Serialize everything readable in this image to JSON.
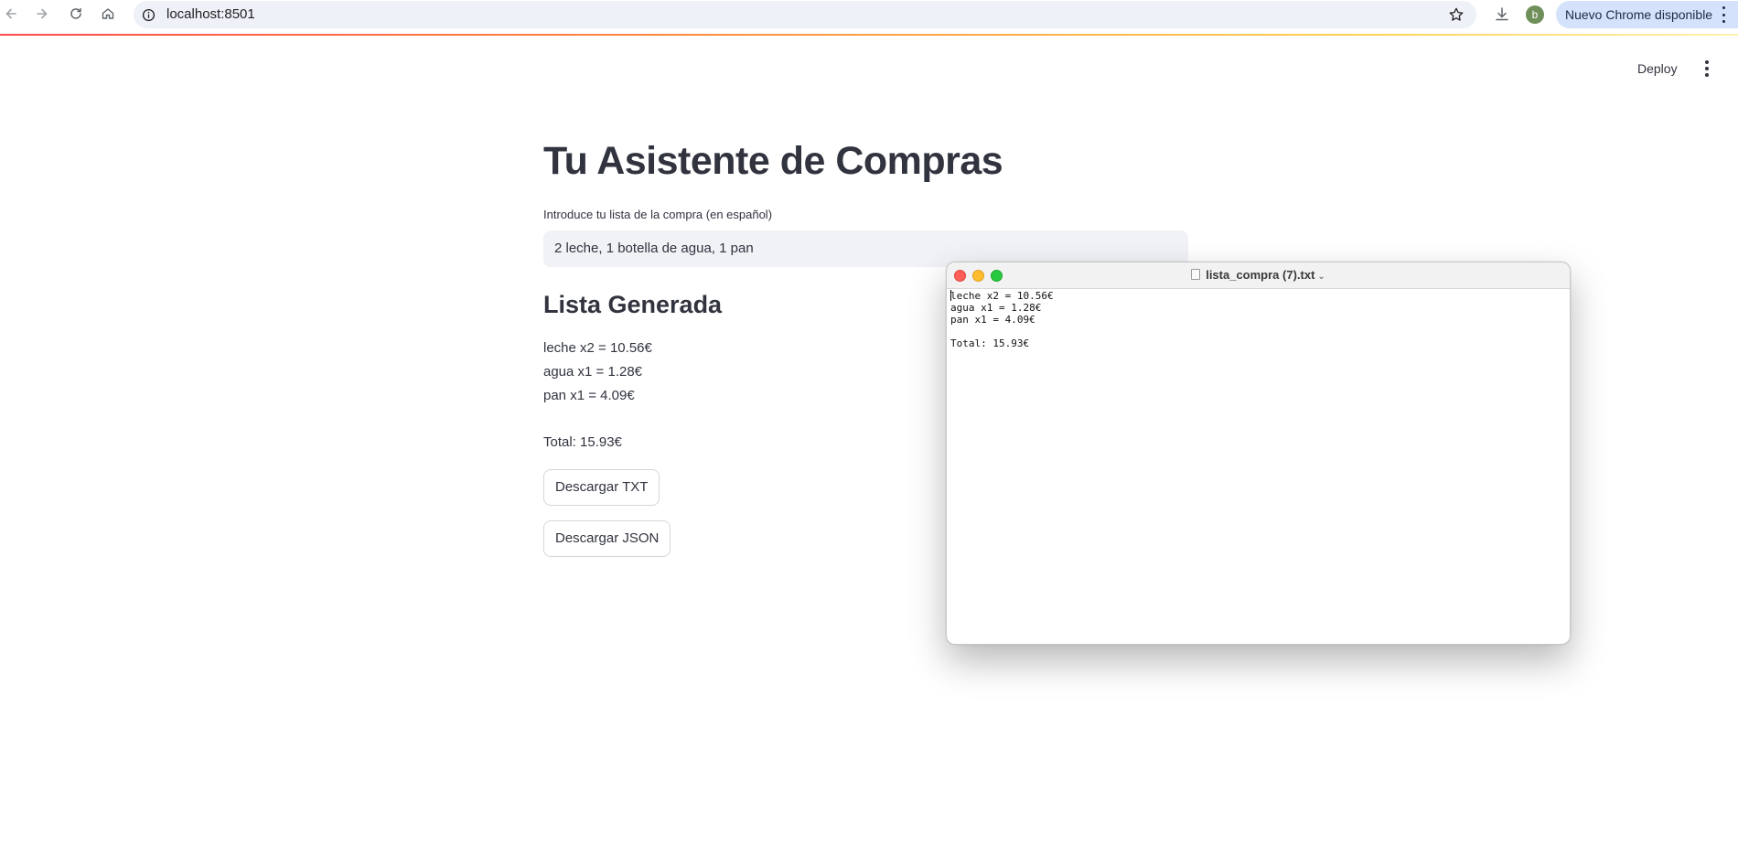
{
  "browser": {
    "url": "localhost:8501",
    "profile_initial": "b",
    "update_label": "Nuevo Chrome disponible",
    "icons": [
      "back-arrow-icon",
      "forward-arrow-icon",
      "reload-icon",
      "home-icon",
      "info-icon",
      "star-icon",
      "download-icon",
      "kebab-menu-icon"
    ]
  },
  "app_header": {
    "deploy_label": "Deploy"
  },
  "main": {
    "title": "Tu Asistente de Compras",
    "input_label": "Introduce tu lista de la compra (en español)",
    "input_value": "2 leche, 1 botella de agua, 1 pan",
    "section_title": "Lista Generada",
    "items": [
      "leche x2 = 10.56€",
      "agua x1 = 1.28€",
      "pan x1 = 4.09€"
    ],
    "total": "Total: 15.93€",
    "download_txt_label": "Descargar TXT",
    "download_json_label": "Descargar JSON"
  },
  "textedit": {
    "filename": "lista_compra (7).txt",
    "lines": [
      "leche x2 = 10.56€",
      "agua x1 = 1.28€",
      "pan x1 = 4.09€",
      "",
      "Total: 15.93€"
    ]
  },
  "colors": {
    "accent_gradient_start": "#ff4b4b",
    "accent_gradient_end": "#fff1b0",
    "input_background": "#f0f2f6",
    "text": "#31333f"
  }
}
